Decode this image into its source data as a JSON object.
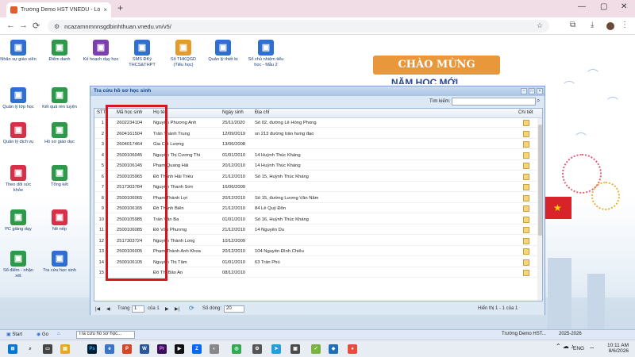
{
  "browser": {
    "tab_title": "Trường Demo HST VNEDU - Lớ",
    "tab_close": "×",
    "new_tab": "+",
    "minimize": "—",
    "maximize": "▢",
    "close": "✕",
    "url": "ncazamnmnnsgdbinhthuan.vnedu.vn/v5/"
  },
  "desktop_icons": [
    {
      "label": "Nhân sự giáo viên",
      "color": "#2e6fd1",
      "icon": "people-icon"
    },
    {
      "label": "Điểm danh",
      "color": "#2d9a4b",
      "icon": "attendance-icon"
    },
    {
      "label": "Kế hoạch dạy học",
      "color": "#7b3fb0",
      "icon": "calendar-icon"
    },
    {
      "label": "SMS ĐKý THCS&THPT",
      "color": "#2e6fd1",
      "icon": "sms-icon"
    },
    {
      "label": "Sổ THKQGD (Tiểu học)",
      "color": "#e69a2b",
      "icon": "sigma-book-icon"
    },
    {
      "label": "Quản lý thiết bị",
      "color": "#2e6fd1",
      "icon": "device-icon"
    },
    {
      "label": "Sổ chủ nhiệm tiểu học - Mẫu 2",
      "color": "#2e6fd1",
      "icon": "notebook-icon"
    },
    {
      "label": "Quản lý lớp học",
      "color": "#2e6fd1",
      "icon": "class-icon"
    },
    {
      "label": "Kết quả rèn luyện",
      "color": "#2d9a4b",
      "icon": "result-icon"
    },
    {
      "label": "Quản lý dịch vụ",
      "color": "#d9304a",
      "icon": "cart-icon"
    },
    {
      "label": "Hồ sơ giáo dục",
      "color": "#2d9a4b",
      "icon": "education-record-icon"
    },
    {
      "label": "Theo dõi sức khỏe",
      "color": "#d9304a",
      "icon": "health-icon"
    },
    {
      "label": "Tổng kết",
      "color": "#2d9a4b",
      "icon": "summary-icon"
    },
    {
      "label": "PC giảng dạy",
      "color": "#2d9a4b",
      "icon": "teaching-icon"
    },
    {
      "label": "Nề nếp",
      "color": "#d9304a",
      "icon": "warning-icon"
    },
    {
      "label": "Sổ điểm - nhận xét",
      "color": "#2d9a4b",
      "icon": "gradebook-icon"
    },
    {
      "label": "Tra cứu học sinh",
      "color": "#2e6fd1",
      "icon": "student-search-icon"
    }
  ],
  "banner": {
    "title": "CHÀO MỪNG",
    "subtitle": "NĂM HỌC MỚI"
  },
  "dialog": {
    "title": "Tra cứu hồ sơ học sinh",
    "search_label": "Tìm kiếm:",
    "search_value": "",
    "columns": [
      "STT",
      "Mã học sinh",
      "Họ tên",
      "Ngày sinh",
      "Địa chỉ",
      "Chi tiết"
    ],
    "rows": [
      {
        "stt": "1",
        "ma": "2602234104",
        "ten": "Nguyễn Phương Anh",
        "ns": "25/11/2020",
        "dc": "Số 02, đường Lê Hồng Phong"
      },
      {
        "stt": "2",
        "ma": "2604161504",
        "ten": "Trần Thành Trung",
        "ns": "12/09/2019",
        "dc": "sn 213 đường trần hưng đạo"
      },
      {
        "stt": "3",
        "ma": "2604017464",
        "ten": "Gia Cát Lượng",
        "ns": "13/06/2008",
        "dc": ""
      },
      {
        "stt": "4",
        "ma": "2500106045",
        "ten": "Nguyễn Thị Cương Thi",
        "ns": "01/01/2010",
        "dc": "14 Huỳnh Thúc Kháng"
      },
      {
        "stt": "5",
        "ma": "2500106145",
        "ten": "Phạm Quang Hải",
        "ns": "20/12/2010",
        "dc": "14 Huỳnh Thúc Kháng"
      },
      {
        "stt": "6",
        "ma": "2500105965",
        "ten": "Đỗ Thành Hải Triều",
        "ns": "21/12/2010",
        "dc": "Số 15, Huỳnh Thúc Kháng"
      },
      {
        "stt": "7",
        "ma": "2517303784",
        "ten": "Nguyễn Thanh Sơn",
        "ns": "16/06/2009",
        "dc": ""
      },
      {
        "stt": "8",
        "ma": "2500106065",
        "ten": "Phạm Thành Lợi",
        "ns": "20/12/2010",
        "dc": "Số 15, đường Lương Văn Năm"
      },
      {
        "stt": "9",
        "ma": "2500106165",
        "ten": "Đỗ Thành Biển",
        "ns": "21/12/2010",
        "dc": "84 Lê Quý Đôn"
      },
      {
        "stt": "10",
        "ma": "2500105985",
        "ten": "Trần Văn Ba",
        "ns": "01/01/2010",
        "dc": "Số 16, Huỳnh Thúc Kháng"
      },
      {
        "stt": "11",
        "ma": "2500106085",
        "ten": "Đỗ Văn Phương",
        "ns": "21/12/2010",
        "dc": "14 Nguyễn Du"
      },
      {
        "stt": "12",
        "ma": "2517303724",
        "ten": "Nguyễn Thành Long",
        "ns": "10/12/2009",
        "dc": ""
      },
      {
        "stt": "13",
        "ma": "2500106005",
        "ten": "Phạm Thành Anh Khoa",
        "ns": "20/12/2010",
        "dc": "104 Nguyễn Đình Chiểu"
      },
      {
        "stt": "14",
        "ma": "2500106105",
        "ten": "Nguyễn Thị Tâm",
        "ns": "01/01/2010",
        "dc": "63 Trần Phú"
      },
      {
        "stt": "15",
        "ma": "",
        "ten": "Đỗ Thị Bảo An",
        "ns": "08/12/2010",
        "dc": ""
      }
    ],
    "pager": {
      "first": "|◀",
      "prev": "◀",
      "page_label": "Trang",
      "page_value": "1",
      "of_label": "của 1",
      "next": "▶",
      "last": "▶|",
      "refresh": "⟳",
      "rows_label": "Số dòng:",
      "rows_value": "20",
      "display_info": "Hiển thị 1 - 1 của 1"
    }
  },
  "appbar": {
    "start": "Start",
    "go": "Go",
    "task": "Tra cứu hồ sơ học...",
    "school": "Trường Demo HST...",
    "year": "2025-2026"
  },
  "taskbar": {
    "lang": "ENG",
    "time": "10:11 AM",
    "date": "8/6/2026"
  }
}
